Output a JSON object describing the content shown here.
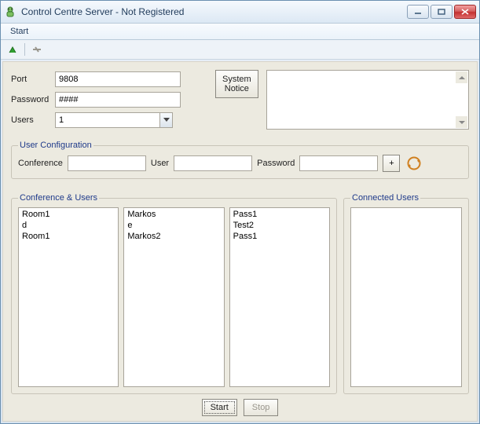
{
  "window": {
    "title": "Control Centre Server - Not Registered"
  },
  "menubar": {
    "start": "Start"
  },
  "form": {
    "port_label": "Port",
    "port_value": "9808",
    "password_label": "Password",
    "password_value": "####",
    "users_label": "Users",
    "users_value": "1"
  },
  "system_notice": {
    "line1": "System",
    "line2": "Notice",
    "text": ""
  },
  "user_config": {
    "legend": "User Configuration",
    "conference_label": "Conference",
    "conference_value": "",
    "user_label": "User",
    "user_value": "",
    "password_label": "Password",
    "password_value": "",
    "add_label": "+"
  },
  "conf_users": {
    "legend": "Conference & Users",
    "col1": [
      "Room1",
      "d",
      "Room1"
    ],
    "col2": [
      "Markos",
      "e",
      "Markos2"
    ],
    "col3": [
      "Pass1",
      "Test2",
      "Pass1"
    ]
  },
  "connected_users": {
    "legend": "Connected Users",
    "items": []
  },
  "buttons": {
    "start": "Start",
    "stop": "Stop"
  }
}
